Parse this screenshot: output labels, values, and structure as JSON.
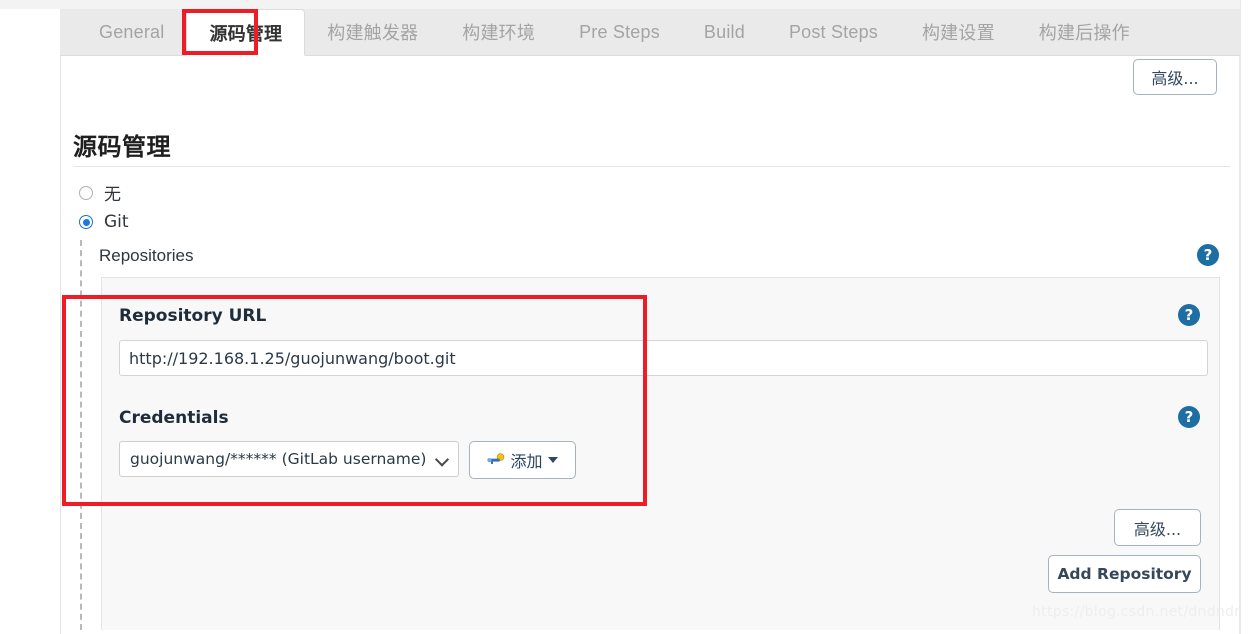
{
  "tabs": [
    {
      "label": "General",
      "active": false,
      "cjk": false
    },
    {
      "label": "源码管理",
      "active": true,
      "cjk": true
    },
    {
      "label": "构建触发器",
      "active": false,
      "cjk": true
    },
    {
      "label": "构建环境",
      "active": false,
      "cjk": true
    },
    {
      "label": "Pre Steps",
      "active": false,
      "cjk": false
    },
    {
      "label": "Build",
      "active": false,
      "cjk": false
    },
    {
      "label": "Post Steps",
      "active": false,
      "cjk": false
    },
    {
      "label": "构建设置",
      "active": false,
      "cjk": true
    },
    {
      "label": "构建后操作",
      "active": false,
      "cjk": true
    }
  ],
  "toolbar": {
    "advanced_top_label": "高级..."
  },
  "section": {
    "title": "源码管理"
  },
  "scm_options": [
    {
      "label": "无",
      "checked": false
    },
    {
      "label": "Git",
      "checked": true
    }
  ],
  "repositories": {
    "label": "Repositories",
    "help_icon": "help-icon",
    "repository_url": {
      "label": "Repository URL",
      "value": "http://192.168.1.25/guojunwang/boot.git",
      "placeholder": "",
      "help_icon": "help-icon"
    },
    "credentials": {
      "label": "Credentials",
      "selected": "guojunwang/****** (GitLab  username)",
      "add_button_label": "添加",
      "add_button_icon": "key-icon",
      "caret_icon": "caret-down-icon",
      "help_icon": "help-icon"
    },
    "advanced_label": "高级...",
    "add_repository_label": "Add Repository"
  },
  "annotations": {
    "tab_highlight_color": "#ee1c25",
    "form_highlight_color": "#ee1c25"
  },
  "watermark": "https://blog.csdn.net/dndndnnfj",
  "colors": {
    "accent_blue": "#1b7ae0",
    "help_blue": "#1d6ea3",
    "annotation_red": "#ee1c25",
    "tabbar_bg": "#eaeaea",
    "panel_bg": "#f8f8f8"
  }
}
